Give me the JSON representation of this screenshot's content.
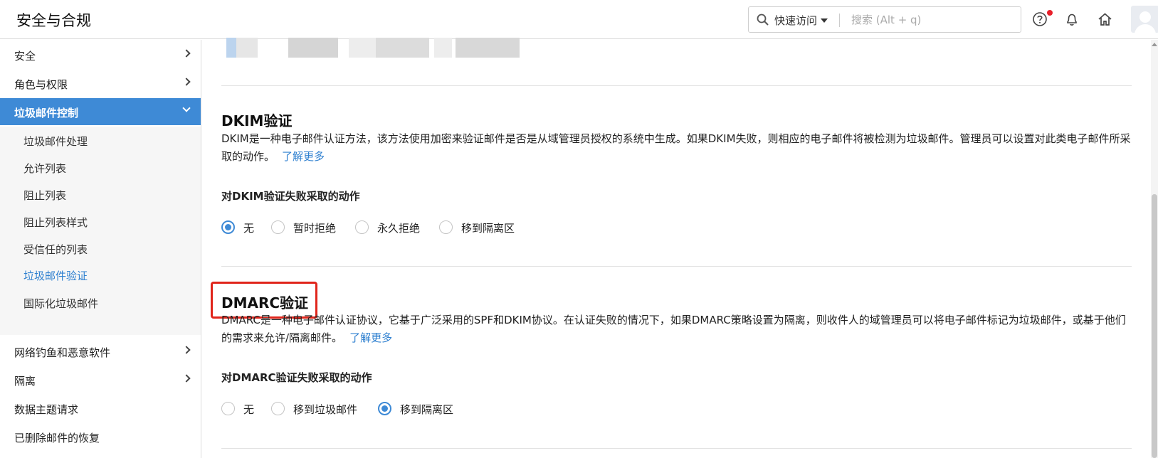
{
  "header": {
    "title": "安全与合规",
    "quick_access": "快速访问",
    "search_placeholder": "搜索 (Alt + q)"
  },
  "sidebar": {
    "items": [
      {
        "label": "安全"
      },
      {
        "label": "角色与权限"
      },
      {
        "label": "垃圾邮件控制"
      },
      {
        "label": "网络钓鱼和恶意软件"
      },
      {
        "label": "隔离"
      },
      {
        "label": "数据主题请求"
      },
      {
        "label": "已删除邮件的恢复"
      }
    ],
    "sub_items": [
      {
        "label": "垃圾邮件处理"
      },
      {
        "label": "允许列表"
      },
      {
        "label": "阻止列表"
      },
      {
        "label": "阻止列表样式"
      },
      {
        "label": "受信任的列表"
      },
      {
        "label": "垃圾邮件验证"
      },
      {
        "label": "国际化垃圾邮件"
      }
    ]
  },
  "dkim": {
    "title": "DKIM验证",
    "description": "DKIM是一种电子邮件认证方法，该方法使用加密来验证邮件是否是从域管理员授权的系统中生成。如果DKIM失败，则相应的电子邮件将被检测为垃圾邮件。管理员可以设置对此类电子邮件所采取的动作。",
    "learn_more": "了解更多",
    "action_title": "对DKIM验证失败采取的动作",
    "options": [
      {
        "label": "无"
      },
      {
        "label": "暂时拒绝"
      },
      {
        "label": "永久拒绝"
      },
      {
        "label": "移到隔离区"
      }
    ],
    "selected": "无"
  },
  "dmarc": {
    "title": "DMARC验证",
    "description": "DMARC是一种电子邮件认证协议，它基于广泛采用的SPF和DKIM协议。在认证失败的情况下，如果DMARC策略设置为隔离，则收件人的域管理员可以将电子邮件标记为垃圾邮件，或基于他们的需求来允许/隔离邮件。",
    "learn_more": "了解更多",
    "action_title": "对DMARC验证失败采取的动作",
    "options": [
      {
        "label": "无"
      },
      {
        "label": "移到垃圾邮件"
      },
      {
        "label": "移到隔离区"
      }
    ],
    "selected": "移到隔离区"
  },
  "colors": {
    "accent": "#3e8ad6",
    "link": "#2f80d0",
    "highlight": "#e0251b",
    "notification_dot": "#e8202a"
  },
  "icons": [
    "search-icon",
    "help-icon",
    "bell-icon",
    "home-icon",
    "chevron-right-icon",
    "chevron-down-icon",
    "avatar"
  ]
}
